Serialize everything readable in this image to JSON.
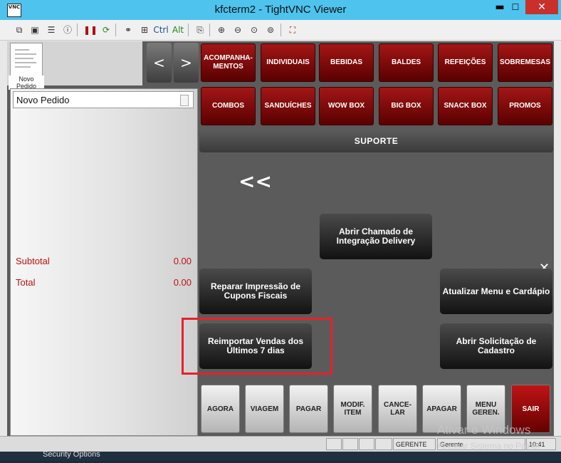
{
  "window": {
    "title": "kfcterm2 - TightVNC Viewer",
    "logo": "VNC"
  },
  "window_controls": {
    "minimize": "▬",
    "maximize": "☐",
    "close": "✕"
  },
  "toolbar": {
    "ctrl": "Ctrl",
    "alt": "Alt"
  },
  "order": {
    "thumb_label": "Novo Pedido",
    "title": "Novo Pedido",
    "subtotal_label": "Subtotal",
    "subtotal_value": "0.00",
    "total_label": "Total",
    "total_value": "0.00"
  },
  "nav": {
    "prev": "<",
    "next": ">"
  },
  "categories_row1": [
    "ACOMPANHA-MENTOS",
    "INDIVIDUAIS",
    "BEBIDAS",
    "BALDES",
    "REFEIÇÕES",
    "SOBREMESAS"
  ],
  "categories_row2": [
    "COMBOS",
    "SANDUÍCHES",
    "WOW BOX",
    "BIG BOX",
    "SNACK BOX",
    "PROMOS"
  ],
  "support": {
    "header": "SUPORTE",
    "back": "<<",
    "close": "✕",
    "btn_integration": "Abrir Chamado de Integração Delivery",
    "btn_repair": "Reparar Impressão de Cupons Fiscais",
    "btn_update_menu": "Atualizar Menu e Cardápio",
    "btn_reimport": "Reimportar Vendas dos Últimos 7 dias",
    "btn_register": "Abrir Solicitação de Cadastro"
  },
  "bottom": [
    "AGORA",
    "VIAGEM",
    "PAGAR",
    "MODIF. ITEM",
    "CANCE-LAR",
    "APAGAR",
    "MENU GEREN.",
    "SAIR"
  ],
  "status": {
    "role": "GERENTE",
    "user": "Gerente",
    "time": "10:41 AM"
  },
  "watermark": {
    "line1": "Ativar o Windows",
    "line2": "Acessar Sistema no Painel"
  },
  "desktop": {
    "text": "Security Options"
  },
  "colors": {
    "category": "#8a0f0f",
    "exit": "#b01010",
    "highlight": "#e8202a",
    "titlebar": "#4ec3ee"
  }
}
